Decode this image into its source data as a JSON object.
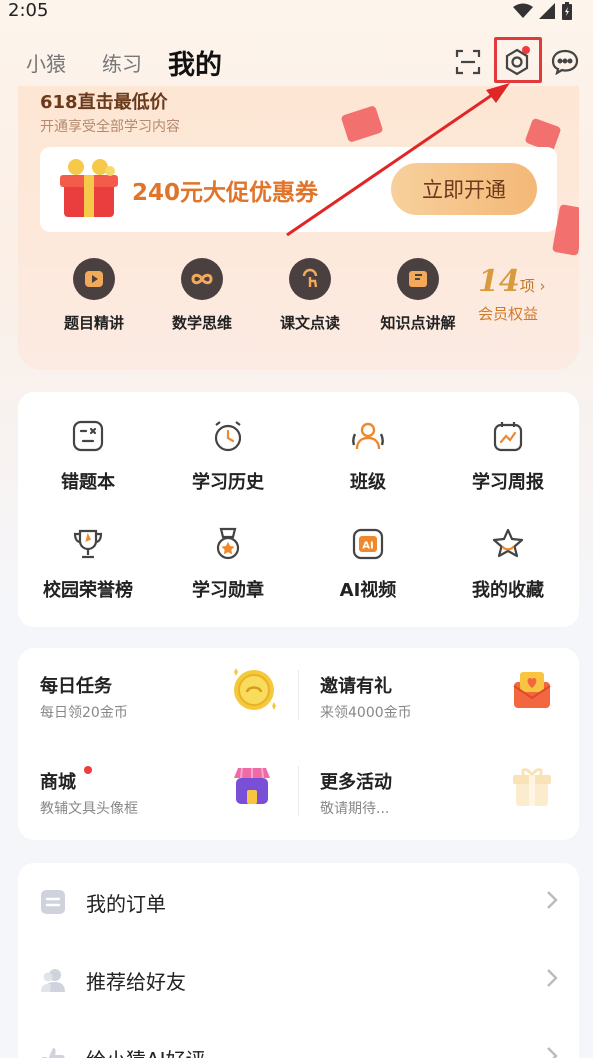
{
  "status": {
    "time": "2:05"
  },
  "nav": {
    "tabs": [
      "小猿",
      "练习",
      "我的"
    ],
    "active_tab": "我的"
  },
  "vip": {
    "title": "618直击最低价",
    "subtitle": "开通享受全部学习内容",
    "coupon_text": "240元大促优惠券",
    "coupon_button": "立即开通",
    "items": [
      "题目精讲",
      "数学思维",
      "课文点读",
      "知识点讲解"
    ],
    "benefit_count": "14",
    "benefit_unit": "项",
    "benefit_label": "会员权益"
  },
  "tools": {
    "items": [
      "错题本",
      "学习历史",
      "班级",
      "学习周报",
      "校园荣誉榜",
      "学习勋章",
      "AI视频",
      "我的收藏"
    ]
  },
  "tasks": {
    "daily_title": "每日任务",
    "daily_sub": "每日领20金币",
    "invite_title": "邀请有礼",
    "invite_sub": "来领4000金币",
    "mall_title": "商城",
    "mall_sub": "教辅文具头像框",
    "more_title": "更多活动",
    "more_sub": "敬请期待..."
  },
  "menu": {
    "items": [
      "我的订单",
      "推荐给好友",
      "给小猿AI好评"
    ]
  },
  "colors": {
    "accent_orange": "#e0742a",
    "highlight_red": "#e23a3a",
    "vip_gold": "#d79a3f"
  }
}
